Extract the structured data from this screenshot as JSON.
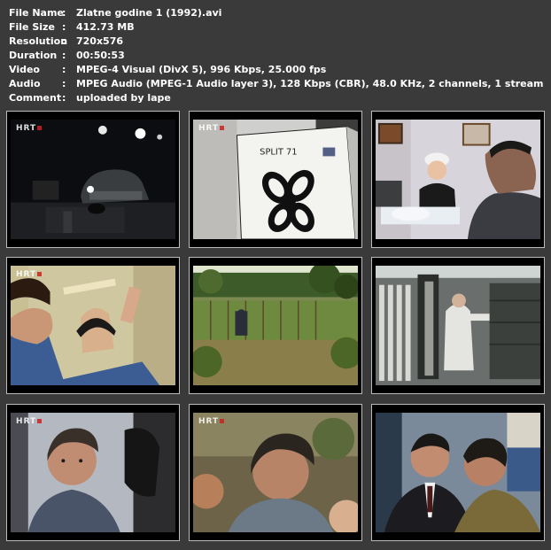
{
  "file_info": [
    {
      "label": "File Name",
      "value": "Zlatne godine 1 (1992).avi"
    },
    {
      "label": "File Size",
      "value": "412.73 MB"
    },
    {
      "label": "Resolution",
      "value": "720x576"
    },
    {
      "label": "Duration",
      "value": "00:50:53"
    },
    {
      "label": "Video",
      "value": "MPEG-4 Visual (DivX 5), 996 Kbps, 25.000 fps"
    },
    {
      "label": "Audio",
      "value": "MPEG Audio (MPEG-1 Audio layer 3), 128 Kbps (CBR), 48.0 KHz, 2 channels, 1 stream"
    },
    {
      "label": "Comment",
      "value": "uploaded by lape"
    }
  ],
  "separator": ":",
  "thumbnails": [
    {
      "logo": "HRT",
      "overlay_text": ""
    },
    {
      "logo": "HRT",
      "overlay_text": "SPLIT 71"
    },
    {
      "logo": "",
      "overlay_text": ""
    },
    {
      "logo": "HRT",
      "overlay_text": ""
    },
    {
      "logo": "",
      "overlay_text": ""
    },
    {
      "logo": "",
      "overlay_text": ""
    },
    {
      "logo": "HRT",
      "overlay_text": ""
    },
    {
      "logo": "HRT",
      "overlay_text": ""
    },
    {
      "logo": "",
      "overlay_text": ""
    }
  ],
  "colors": {
    "background": "#3a3a3a",
    "text": "#ffffff",
    "thumb_border": "#bbbbbb"
  }
}
